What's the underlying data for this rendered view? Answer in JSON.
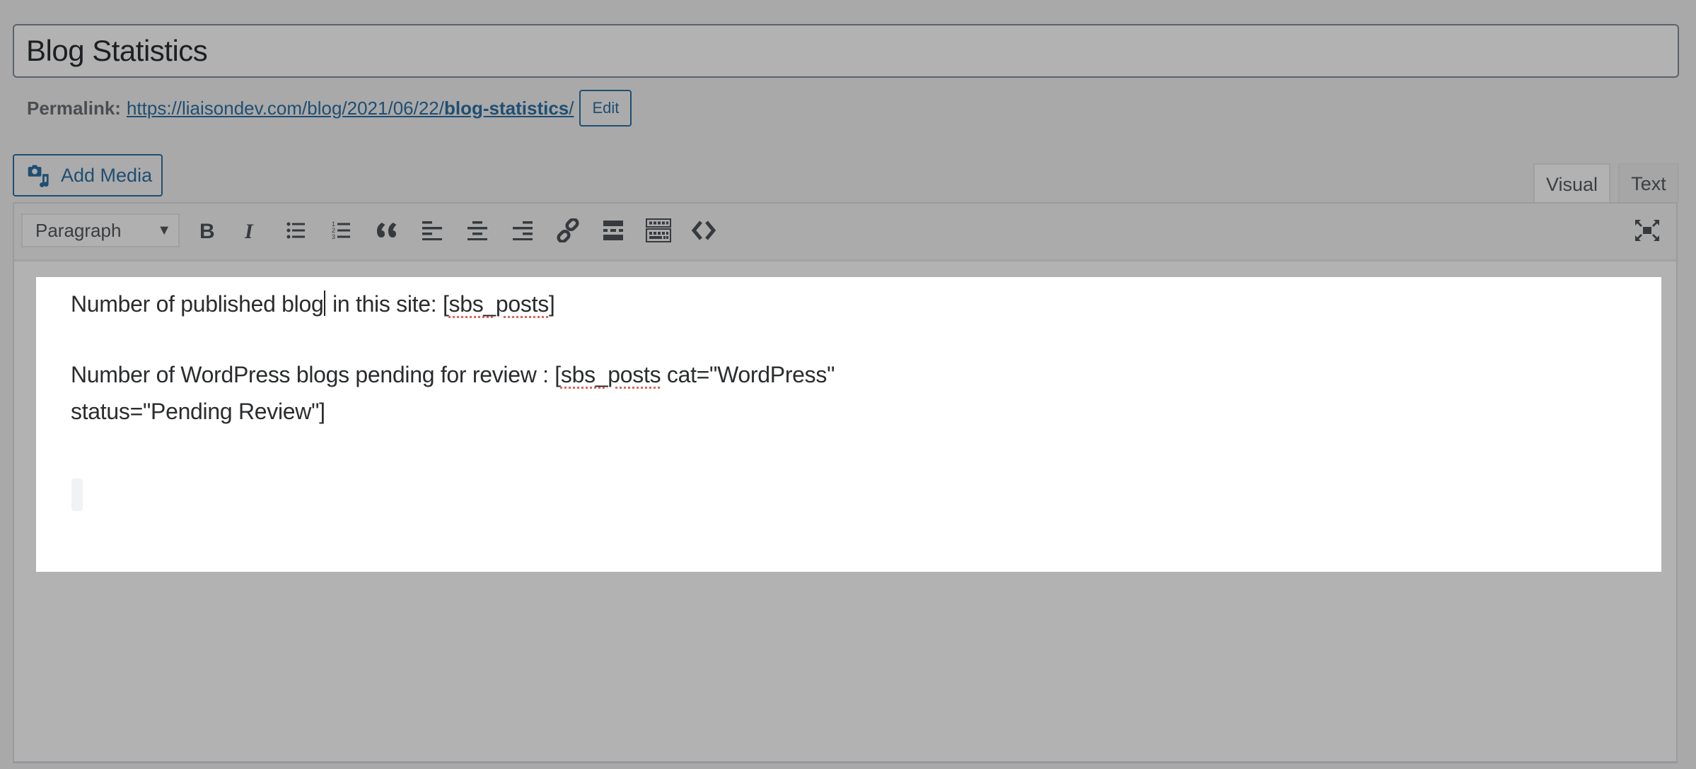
{
  "post": {
    "title": "Blog Statistics"
  },
  "permalink": {
    "label": "Permalink:",
    "url_prefix": "https://liaisondev.com/blog/2021/06/22/",
    "url_slug": "blog-statistics",
    "url_suffix": "/",
    "edit_label": "Edit"
  },
  "media": {
    "add_media_label": "Add Media",
    "icon": "camera-music-icon"
  },
  "editor_tabs": [
    {
      "label": "Visual",
      "active": true
    },
    {
      "label": "Text",
      "active": false
    }
  ],
  "toolbar": {
    "format_select": {
      "selected": "Paragraph"
    },
    "buttons": [
      {
        "name": "bold",
        "icon": "bold-icon"
      },
      {
        "name": "italic",
        "icon": "italic-icon"
      },
      {
        "name": "bulleted-list",
        "icon": "bulleted-list-icon"
      },
      {
        "name": "numbered-list",
        "icon": "numbered-list-icon"
      },
      {
        "name": "blockquote",
        "icon": "quote-icon"
      },
      {
        "name": "align-left",
        "icon": "align-left-icon"
      },
      {
        "name": "align-center",
        "icon": "align-center-icon"
      },
      {
        "name": "align-right",
        "icon": "align-right-icon"
      },
      {
        "name": "insert-link",
        "icon": "link-icon"
      },
      {
        "name": "read-more",
        "icon": "read-more-icon"
      },
      {
        "name": "toolbar-toggle",
        "icon": "keyboard-icon"
      },
      {
        "name": "code",
        "icon": "code-icon"
      },
      {
        "name": "fullscreen",
        "icon": "fullscreen-icon"
      }
    ]
  },
  "content": {
    "line1_before_caret": "Number of published blog",
    "line1_after_caret": " in this site: [",
    "line1_shortcode": "sbs_posts",
    "line1_end": "]",
    "line2_prefix": "Number of WordPress blogs pending for review : [",
    "line2_shortcode": "sbs_posts",
    "line2_rest": " cat=\"WordPress\"",
    "line3": "status=\"Pending Review\"]"
  },
  "colors": {
    "link": "#1f4e72",
    "spellcheck": "#e0645a",
    "overlay_bg": "#a9a9a9"
  }
}
